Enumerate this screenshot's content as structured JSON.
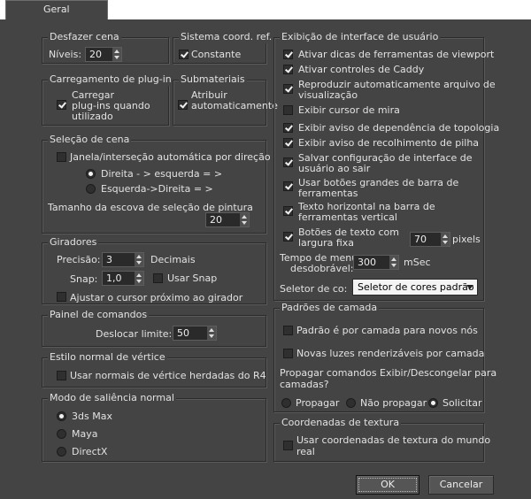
{
  "tab": {
    "label": "Geral"
  },
  "undo": {
    "title": "Desfazer cena",
    "levels_label": "Níveis:",
    "levels_value": "20"
  },
  "coord": {
    "title": "Sistema coord. ref.",
    "constant_label": "Constante",
    "constant_checked": true
  },
  "plugin": {
    "title": "Carregamento de plug-in",
    "load_label_1": "Carregar",
    "load_label_2": "plug-ins quando",
    "load_label_3": "utilizado",
    "load_checked": true
  },
  "submaterials": {
    "title": "Submateriais",
    "assign_label_1": "Atribuir",
    "assign_label_2": "automaticamente",
    "assign_checked": true
  },
  "scene_selection": {
    "title": "Seleção de cena",
    "auto_window_label": "Janela/interseção automática por direção",
    "auto_window_checked": false,
    "rtl_label": "Direita - > esquerda = >",
    "ltr_label": "Esquerda->Direita = >",
    "brush_label": "Tamanho da escova de seleção de pintura",
    "brush_value": "20"
  },
  "spinners": {
    "title": "Giradores",
    "precision_label": "Precisão:",
    "precision_value": "3",
    "decimals_label": "Decimais",
    "snap_label": "Snap:",
    "snap_value": "1,0",
    "use_snap_label": "Usar Snap",
    "wrap_cursor_label": "Ajustar o cursor próximo ao girador"
  },
  "command_panel": {
    "title": "Painel de comandos",
    "rollout_label": "Deslocar limite:",
    "rollout_value": "50"
  },
  "vertex_normal": {
    "title": "Estilo normal de vértice",
    "legacy_label": "Usar normais de vértice herdadas do R4"
  },
  "bump_mode": {
    "title": "Modo de saliência normal",
    "options": [
      "3ds Max",
      "Maya",
      "DirectX"
    ],
    "selected": 0
  },
  "ui_display": {
    "title": "Exibição de interface de usuário",
    "items": [
      {
        "l1": "Ativar dicas de ferramentas de viewport",
        "l2": "",
        "checked": true
      },
      {
        "l1": "Ativar controles de Caddy",
        "l2": "",
        "checked": true
      },
      {
        "l1": "Reproduzir automaticamente arquivo de",
        "l2": "visualização",
        "checked": true
      },
      {
        "l1": "Exibir cursor de mira",
        "l2": "",
        "checked": false
      },
      {
        "l1": "Exibir aviso de dependência de topologia",
        "l2": "",
        "checked": true
      },
      {
        "l1": "Exibir aviso de recolhimento de pilha",
        "l2": "",
        "checked": true
      },
      {
        "l1": "Salvar configuração de interface de",
        "l2": "usuário ao sair",
        "checked": true
      },
      {
        "l1": "Usar botões grandes de barra de",
        "l2": "ferramentas",
        "checked": true
      },
      {
        "l1": "Texto horizontal na barra de",
        "l2": "ferramentas vertical",
        "checked": true
      },
      {
        "l1": "Botões de texto com",
        "l2": "largura fixa",
        "checked": true
      }
    ],
    "fixed_width_value": "70",
    "pixels_label": "pixels",
    "flyout_label_1": "Tempo de menu",
    "flyout_label_2": "desdobrável:",
    "flyout_value": "300",
    "msec_label": "mSec",
    "color_selector_label": "Seletor de co:",
    "color_selector_value": "Seletor de cores padrão"
  },
  "layer_defaults": {
    "title": "Padrões de camada",
    "default_by_layer_label": "Padrão é por camada para novos nós",
    "new_lights_label": "Novas luzes renderizáveis por camada",
    "propagate_label_1": "Propagar comandos Exibir/Descongelar para",
    "propagate_label_2": "camadas?",
    "options": [
      "Propagar",
      "Não propagar",
      "Solicitar"
    ],
    "selected": 2
  },
  "texture_coords": {
    "title": "Coordenadas de textura",
    "real_world_label_1": "Usar coordenadas de textura do mundo",
    "real_world_label_2": "real"
  },
  "buttons": {
    "ok": "OK",
    "cancel": "Cancelar"
  }
}
